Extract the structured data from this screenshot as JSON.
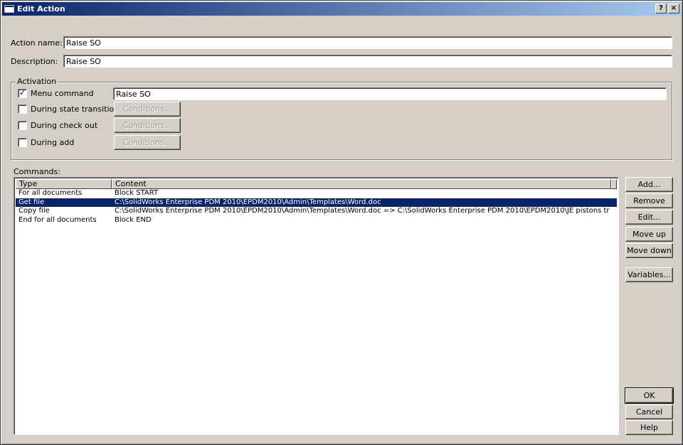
{
  "window": {
    "title": "Edit Action",
    "help_button": "?",
    "close_button": "×"
  },
  "form": {
    "action_name_label": "Action name:",
    "action_name_value": "Raise SO",
    "description_label": "Description:",
    "description_value": "Raise SO"
  },
  "activation": {
    "legend": "Activation",
    "menu_command": {
      "label": "Menu command",
      "checked": true,
      "value": "Raise SO"
    },
    "state_transition": {
      "label": "During state transition",
      "checked": false,
      "button": "Conditions..."
    },
    "check_out": {
      "label": "During check out",
      "checked": false,
      "button": "Conditions..."
    },
    "add": {
      "label": "During add",
      "checked": false,
      "button": "Conditions..."
    }
  },
  "commands": {
    "label": "Commands:",
    "columns": [
      "Type",
      "Content"
    ],
    "rows": [
      {
        "type": "For all documents",
        "content": "Block START",
        "selected": false
      },
      {
        "type": "Get file",
        "content": "C:\\SolidWorks Enterprise PDM 2010\\EPDM2010\\Admin\\Templates\\Word.doc",
        "selected": true
      },
      {
        "type": "Copy file",
        "content": "C:\\SolidWorks Enterprise PDM 2010\\EPDM2010\\Admin\\Templates\\Word.doc => C:\\SolidWorks Enterprise PDM 2010\\EPDM2010\\JE pistons trial\\Word.doc",
        "selected": false
      },
      {
        "type": "End for all documents",
        "content": "Block END",
        "selected": false
      }
    ]
  },
  "side_buttons": {
    "add": "Add...",
    "remove": "Remove",
    "edit": "Edit...",
    "move_up": "Move up",
    "move_down": "Move down",
    "variables": "Variables..."
  },
  "dialog_buttons": {
    "ok": "OK",
    "cancel": "Cancel",
    "help": "Help"
  },
  "colors": {
    "title_bar": "#0a246a",
    "selection": "#0a246a",
    "face": "#d4d0c8"
  }
}
